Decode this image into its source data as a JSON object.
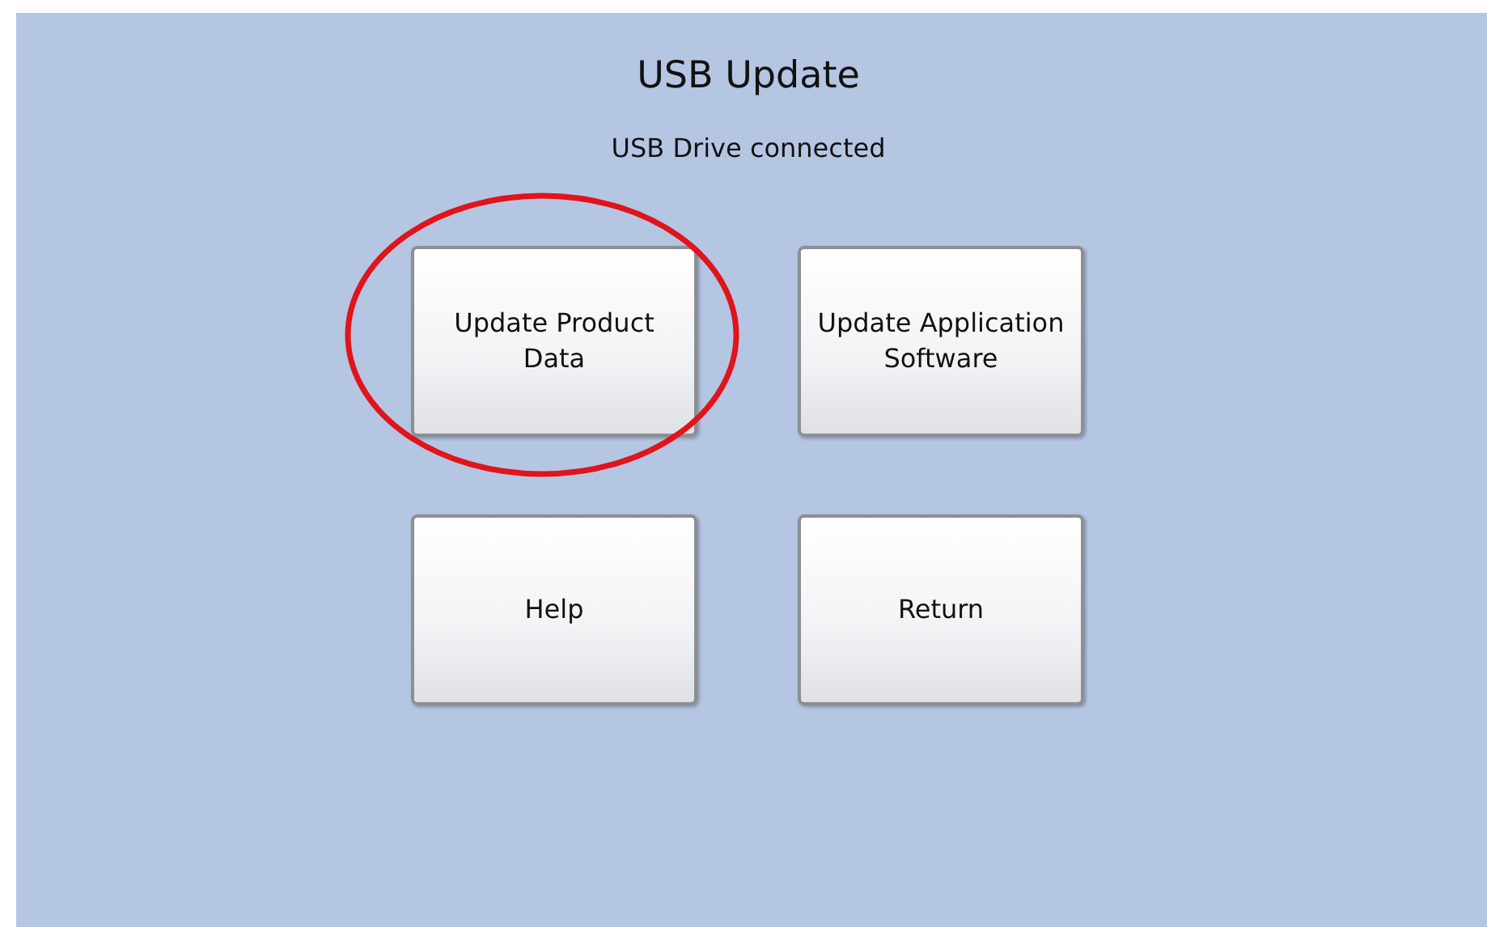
{
  "title": "USB Update",
  "status": "USB Drive connected",
  "buttons": [
    {
      "label": "Update Product Data",
      "circled": true
    },
    {
      "label": "Update Application Software",
      "circled": false
    },
    {
      "label": "Help",
      "circled": false
    },
    {
      "label": "Return",
      "circled": false
    }
  ]
}
